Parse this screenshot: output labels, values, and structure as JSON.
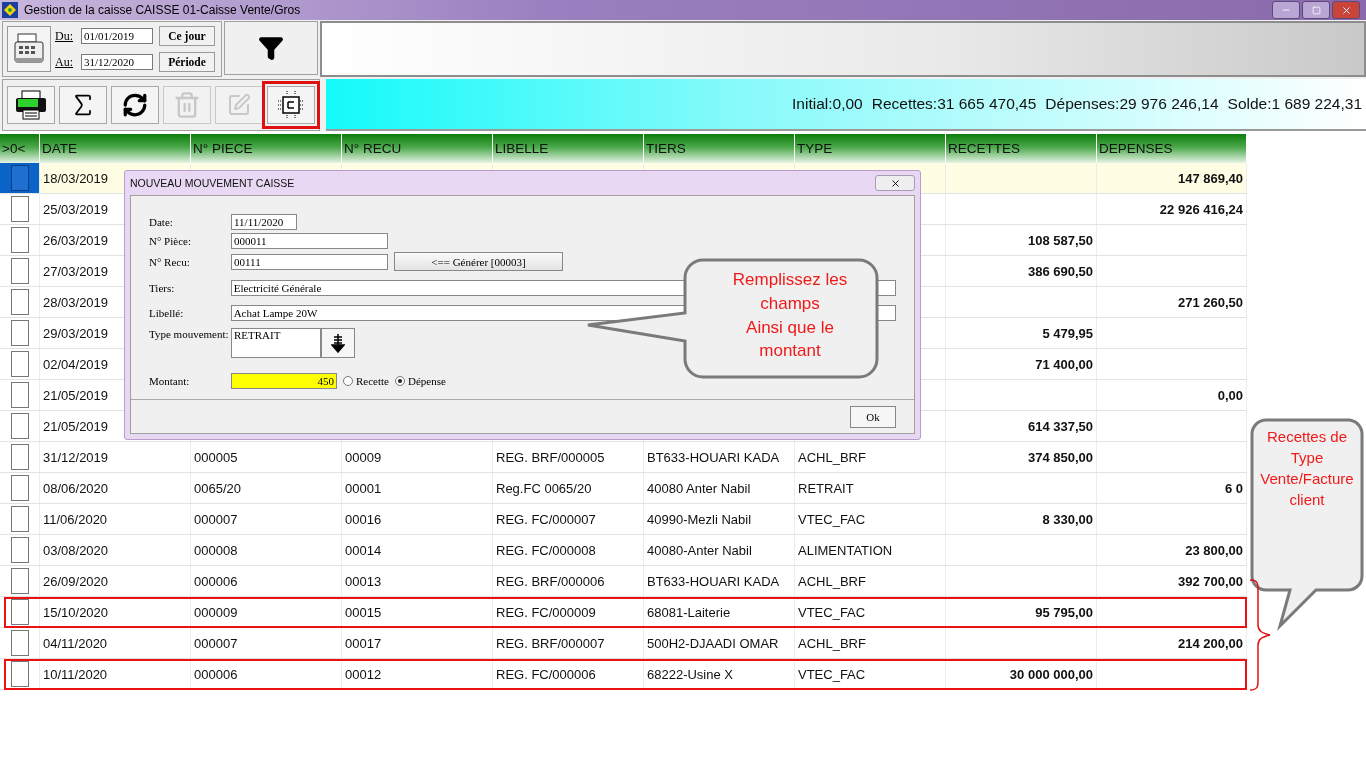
{
  "window": {
    "title": "Gestion de la caisse CAISSE 01-Caisse Vente/Gros"
  },
  "period": {
    "from_label": "Du:",
    "from_value": "01/01/2019",
    "to_label": "Au:",
    "to_value": "31/12/2020",
    "buttons": [
      "Ce jour",
      "Période"
    ]
  },
  "toolbar": [
    {
      "kind": "xls",
      "disabled": false,
      "highlighted": false
    },
    {
      "kind": "sum",
      "disabled": false,
      "highlighted": false
    },
    {
      "kind": "refresh",
      "disabled": false,
      "highlighted": false
    },
    {
      "kind": "delete",
      "disabled": true,
      "highlighted": false
    },
    {
      "kind": "edit",
      "disabled": true,
      "highlighted": false
    },
    {
      "kind": "cash",
      "disabled": false,
      "highlighted": true
    }
  ],
  "summary": [
    "Initial:0,00",
    "Recettes:31 665 470,45",
    "Dépenses:29 976 246,14",
    "Solde:1 689 224,31"
  ],
  "table": {
    "columns": [
      ">0<",
      "DATE",
      "N° PIECE",
      "N° RECU",
      "LIBELLE",
      "TIERS",
      "TYPE",
      "RECETTES",
      "DEPENSES"
    ],
    "rows": [
      {
        "selected": true,
        "highlighted": false,
        "date": "18/03/2019",
        "depenses": "147 869,40"
      },
      {
        "selected": false,
        "highlighted": false,
        "date": "25/03/2019",
        "depenses": "22 926 416,24"
      },
      {
        "selected": false,
        "highlighted": false,
        "date": "26/03/2019",
        "recettes": "108 587,50"
      },
      {
        "selected": false,
        "highlighted": false,
        "date": "27/03/2019",
        "recettes": "386 690,50"
      },
      {
        "selected": false,
        "highlighted": false,
        "date": "28/03/2019",
        "depenses": "271 260,50"
      },
      {
        "selected": false,
        "highlighted": false,
        "date": "29/03/2019",
        "recettes": "5 479,95"
      },
      {
        "selected": false,
        "highlighted": false,
        "date": "02/04/2019",
        "recettes": "71 400,00"
      },
      {
        "selected": false,
        "highlighted": false,
        "date": "21/05/2019",
        "depenses": "0,00"
      },
      {
        "selected": false,
        "highlighted": false,
        "date": "21/05/2019",
        "recettes": "614 337,50"
      },
      {
        "selected": false,
        "highlighted": false,
        "date": "31/12/2019",
        "piece": "000005",
        "recu": "00009",
        "libelle": "REG. BRF/000005",
        "tiers": "BT633-HOUARI KADA",
        "type": "ACHL_BRF",
        "recettes": "374 850,00"
      },
      {
        "selected": false,
        "highlighted": false,
        "date": "08/06/2020",
        "piece": "0065/20",
        "recu": "00001",
        "libelle": "Reg.FC 0065/20",
        "tiers": "40080  Anter Nabil",
        "type": "RETRAIT",
        "depenses": "6 0"
      },
      {
        "selected": false,
        "highlighted": false,
        "date": "11/06/2020",
        "piece": "000007",
        "recu": "00016",
        "libelle": "REG. FC/000007",
        "tiers": "40990-Mezli Nabil",
        "type": "VTEC_FAC",
        "recettes": "8 330,00"
      },
      {
        "selected": false,
        "highlighted": false,
        "date": "03/08/2020",
        "piece": "000008",
        "recu": "00014",
        "libelle": "REG. FC/000008",
        "tiers": "40080-Anter Nabil",
        "type": "ALIMENTATION",
        "depenses": "23 800,00"
      },
      {
        "selected": false,
        "highlighted": false,
        "date": "26/09/2020",
        "piece": "000006",
        "recu": "00013",
        "libelle": "REG. BRF/000006",
        "tiers": "BT633-HOUARI KADA",
        "type": "ACHL_BRF",
        "depenses": "392 700,00"
      },
      {
        "selected": false,
        "highlighted": true,
        "date": "15/10/2020",
        "piece": "000009",
        "recu": "00015",
        "libelle": "REG. FC/000009",
        "tiers": "68081-Laiterie",
        "type": "VTEC_FAC",
        "recettes": "95 795,00"
      },
      {
        "selected": false,
        "highlighted": false,
        "date": "04/11/2020",
        "piece": "000007",
        "recu": "00017",
        "libelle": "REG. BRF/000007",
        "tiers": "500H2-DJAADI OMAR",
        "type": "ACHL_BRF",
        "depenses": "214 200,00"
      },
      {
        "selected": false,
        "highlighted": true,
        "date": "10/11/2020",
        "piece": "000006",
        "recu": "00012",
        "libelle": "REG. FC/000006",
        "tiers": "68222-Usine X",
        "type": "VTEC_FAC",
        "recettes": "30 000 000,00"
      }
    ]
  },
  "dialog": {
    "title": "NOUVEAU MOUVEMENT CAISSE",
    "date": {
      "label": "Date:",
      "value": "11/11/2020"
    },
    "piece": {
      "label": "N° Pièce:",
      "value": "000011"
    },
    "recu": {
      "label": "N° Recu:",
      "value": "00111"
    },
    "generate_button": "<== Générer [00003]",
    "tiers": {
      "label": "Tiers:",
      "value": "Electricité Générale"
    },
    "libelle": {
      "label": "Libellé:",
      "value": "Achat Lampe 20W"
    },
    "type": {
      "label": "Type mouvement:",
      "value": "RETRAIT"
    },
    "montant": {
      "label": "Montant:",
      "value": "450"
    },
    "radios": [
      {
        "label": "Recette",
        "selected": false
      },
      {
        "label": "Dépense",
        "selected": true
      }
    ],
    "ok_button": "Ok"
  },
  "callouts": [
    {
      "lines": [
        "Remplissez les",
        "champs",
        "Ainsi que le",
        "montant"
      ]
    },
    {
      "lines": [
        "Recettes de",
        "Type",
        "Vente/Facture",
        "client"
      ]
    }
  ]
}
